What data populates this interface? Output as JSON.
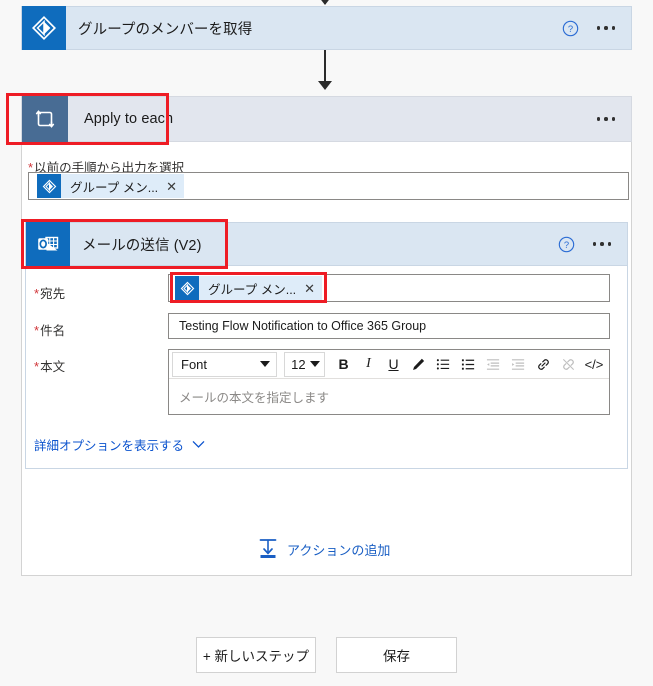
{
  "flow": {
    "step1": {
      "title": "グループのメンバーを取得",
      "icon": "azure-ad-icon",
      "help_label": "?",
      "menu_label": "..."
    },
    "loop": {
      "title": "Apply to each",
      "icon": "loop-icon",
      "menu_label": "...",
      "input_label": "以前の手順から出力を選択",
      "required_mark": "*",
      "token": {
        "text": "グループ メン...",
        "close": "✕",
        "icon": "azure-ad-icon"
      }
    },
    "step2": {
      "title": "メールの送信 (V2)",
      "icon": "outlook-icon",
      "help_label": "?",
      "menu_label": "...",
      "fields": {
        "to": {
          "label": "宛先",
          "required_mark": "*",
          "token": {
            "text": "グループ メン...",
            "close": "✕",
            "icon": "azure-ad-icon"
          }
        },
        "subject": {
          "label": "件名",
          "required_mark": "*",
          "value": "Testing Flow Notification to Office 365 Group"
        },
        "body": {
          "label": "本文",
          "required_mark": "*",
          "placeholder": "メールの本文を指定します"
        }
      },
      "toolbar": {
        "font_label": "Font",
        "size_label": "12",
        "bold": "B",
        "italic": "I",
        "underline": "U",
        "text_color": "pen-icon",
        "numbered_list": "numbered-list-icon",
        "bulleted_list": "bulleted-list-icon",
        "outdent": "outdent-icon",
        "indent": "indent-icon",
        "link": "link-icon",
        "unlink": "unlink-icon",
        "code_view": "</>"
      },
      "advanced_options": "詳細オプションを表示する"
    },
    "add_action": {
      "label": "アクションの追加",
      "icon": "insert-action-icon"
    }
  },
  "footer": {
    "new_step": "+ 新しいステップ",
    "save": "保存"
  },
  "colors": {
    "accent_blue": "#0f6cbd",
    "loop_icon_bg": "#486c94",
    "card_header_bg": "#dae6f2",
    "loop_header_bg": "#e2e6ee",
    "token_bg": "#deecf9",
    "link_blue": "#0b53ce",
    "required_red": "#d13438",
    "annotation_red": "#ee1c25"
  }
}
